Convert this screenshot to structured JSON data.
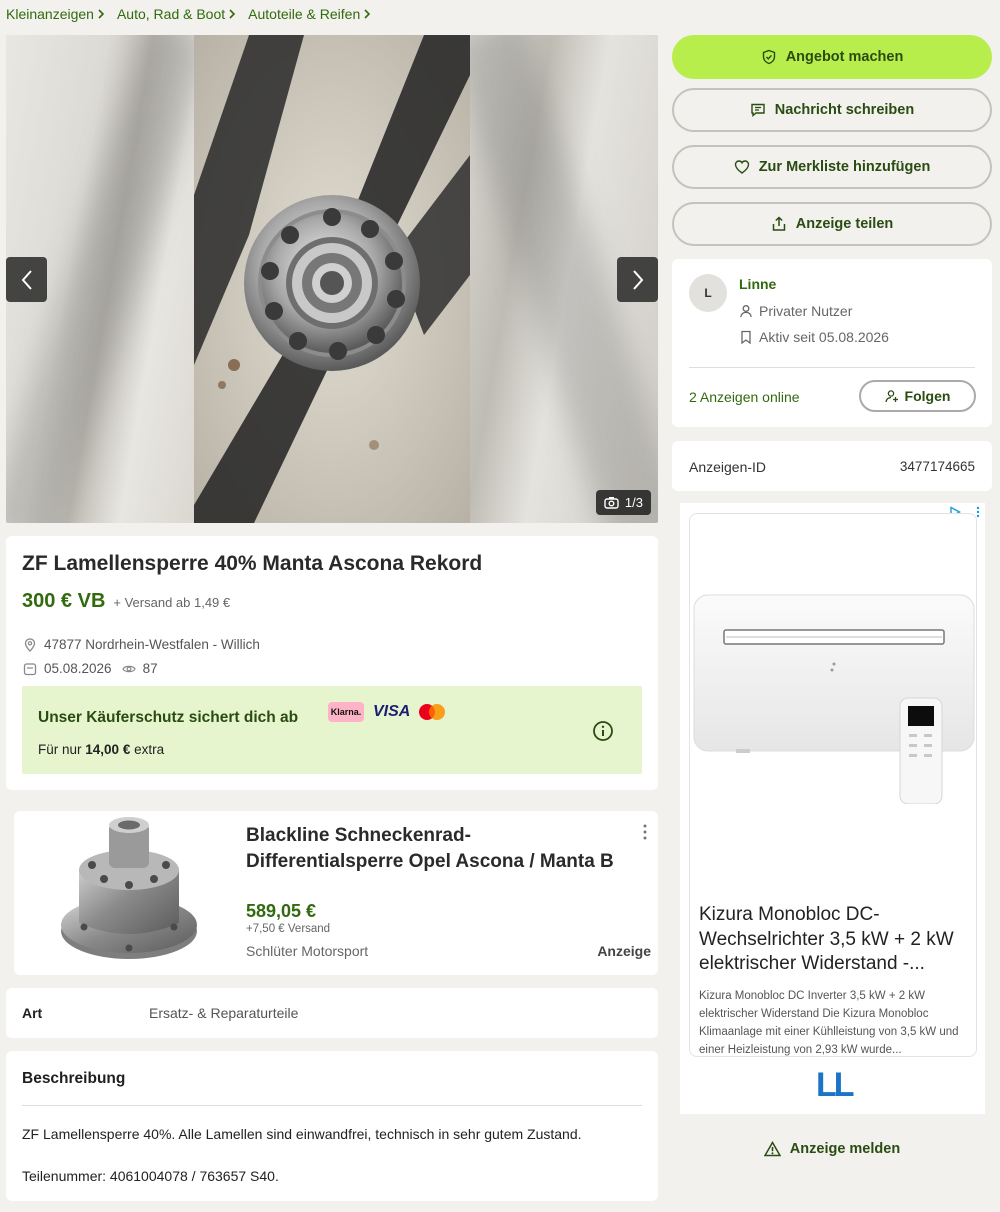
{
  "breadcrumbs": [
    "Kleinanzeigen",
    "Auto, Rad & Boot",
    "Autoteile & Reifen"
  ],
  "gallery": {
    "counter": "1/3"
  },
  "listing": {
    "title": "ZF Lamellensperre 40% Manta Ascona Rekord",
    "price": "300 € VB",
    "shipping": "+ Versand ab 1,49 €",
    "location": "47877 Nordrhein-Westfalen - Willich",
    "date": "05.08.2026",
    "views": "87"
  },
  "protection": {
    "heading": "Unser Käuferschutz sichert dich ab",
    "text_prefix": "Für nur",
    "amount": "14,00 €",
    "text_suffix": "extra",
    "payment_logos": [
      "Klarna.",
      "VISA",
      "mastercard"
    ]
  },
  "sponsored": {
    "title_line1": "Blackline Schneckenrad-",
    "title_line2": "Differentialsperre Opel Ascona / Manta B",
    "price": "589,05 €",
    "shipping": "+7,50 € Versand",
    "vendor": "Schlüter Motorsport",
    "label": "Anzeige"
  },
  "attributes": {
    "key": "Art",
    "value": "Ersatz- & Reparaturteile"
  },
  "description": {
    "heading": "Beschreibung",
    "line1": "ZF Lamellensperre 40%. Alle Lamellen sind einwandfrei, technisch in sehr gutem Zustand.",
    "line2": "Teilenummer: 4061004078 / 763657 S40."
  },
  "actions": {
    "offer": "Angebot machen",
    "message": "Nachricht schreiben",
    "watchlist": "Zur Merkliste hinzufügen",
    "share": "Anzeige teilen",
    "report": "Anzeige melden"
  },
  "seller": {
    "initial": "L",
    "name": "Linne",
    "type": "Privater Nutzer",
    "active_since": "Aktiv seit 05.08.2026",
    "ads_online": "2 Anzeigen online",
    "follow": "Folgen"
  },
  "ad_id": {
    "label": "Anzeigen-ID",
    "value": "3477174665"
  },
  "display_ad": {
    "title": "Kizura Monobloc DC-Wechselrichter 3,5 kW + 2 kW elektrischer Widerstand -...",
    "text": "Kizura Monobloc DC Inverter 3,5 kW + 2 kW elektrischer Widerstand Die Kizura Monobloc Klimaanlage mit einer Kühlleistung von 3,5 kW und einer Heizleistung von 2,93 kW wurde...",
    "logo": "LL"
  },
  "colors": {
    "brand_green": "#326a0f",
    "accent_lime": "#b8ee4b",
    "protect_bg": "#e7f5cf"
  }
}
